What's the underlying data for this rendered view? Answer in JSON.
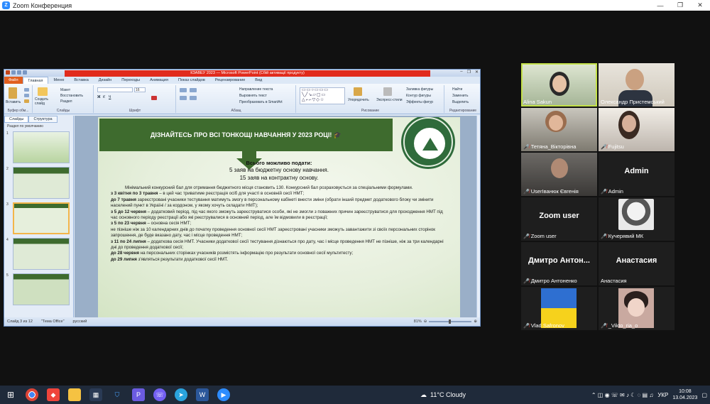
{
  "zoom_window": {
    "title": "Zoom Конференция",
    "controls": [
      "—",
      "❐",
      "✕"
    ]
  },
  "ppt": {
    "title": "КЗАВЕУ 2023 — Microsoft PowerPoint (Сбій активації продукту)",
    "tabs": [
      "Файл",
      "Главная",
      "Меню",
      "Вставка",
      "Дизайн",
      "Переходы",
      "Анимация",
      "Показ слайдов",
      "Рецензирование",
      "Вид"
    ],
    "ribbon": {
      "clipboard_label": "Буфер обм...",
      "insert_btn": "Вставить",
      "create_slide": "Создать слайд",
      "macro": "Макет",
      "restore": "Восстановить",
      "section": "Раздел",
      "slides_label": "Слайды",
      "font_label": "Шрифт",
      "font_size": "16",
      "paragraph_label": "Абзац",
      "text_dir": "Направление текста",
      "align_text": "Выровнять текст",
      "smartart": "Преобразовать в SmartArt",
      "drawing_label": "Рисование",
      "arrange": "Упорядочить",
      "quick_styles": "Экспресс-стили",
      "fill": "Заливка фигуры",
      "outline": "Контур фигуры",
      "effects": "Эффекты фигур",
      "find": "Найти",
      "replace": "Заменить",
      "select": "Выделить",
      "editing_label": "Редактирование"
    },
    "slides_pane": {
      "tabs": [
        "Слайды",
        "Структура"
      ],
      "section": "Раздел по умолчанию",
      "thumbs": [
        "1",
        "2",
        "3",
        "4",
        "5"
      ]
    },
    "slide": {
      "banner": "ДІЗНАЙТЕСЬ ПРО ВСІ ТОНКОЩІ НАВЧАННЯ У 2023 РОЦІ! 🎓",
      "heading": "Всього можливо подати:",
      "line1": "5 заяв на бюджетну основу навчання.",
      "line2": "15 заяв на контрактну основу.",
      "p1": "Мінімальний конкурсний бал для отримання бюджетного місця становить 130. Конкурсний бал розраховується за спеціальними формулами.",
      "b1": "з 3 квітня по 3 травня",
      "t1": " – в цей час триватиме реєстрація осіб для участі в основній сесії НМТ;",
      "b2": "до 7 травня",
      "t2": " зареєстровані учасники тестування матимуть змогу в персональному кабінеті внести зміни (обрати інший предмет додаткового блоку чи змінити населений пункт в Україні / за кордоном, у якому хочуть складати НМТ);",
      "b3": "з 5 до 12 червня",
      "t3": " – додатковий період, під час якого зможуть зареєструватися особи, які не змогли з поважних причин зареєструватися для проходження НМТ під час основного періоду реєстрації або які реєструвалися в основний період, але їм відмовили в реєстрації;",
      "b4": "з 5 по 23 червня",
      "t4": " – основна сесія НМТ;",
      "t5": "не пізніше ніж за 10 календарних днів до початку проведення основної сесії НМТ зареєстровані учасники зможуть завантажити зі своїх персональних сторінок запрошення, де буде вказано дату, час і місце проведення НМТ;",
      "b6": "з 11 по 24 липня",
      "t6": " – додаткова сесія НМТ. Учасники додаткової сесії тестування дізнаються про дату, час і місце проведення НМТ не пізніше, ніж за три календарні дні до проведення додаткової сесії;",
      "b7": "до 28 червня",
      "t7": " на персональних сторінках учасників розмістять інформацію про результати основної сесії мультитесту;",
      "b8": "до 29 липня",
      "t8": " з'являться результати додаткової сесії НМТ."
    },
    "status": {
      "slide": "Слайд 3 из 12",
      "theme": "\"Тема Office\"",
      "lang": "русский",
      "zoom": "81%"
    }
  },
  "participants": [
    {
      "name": "Alina Sakun",
      "muted": false,
      "video": true
    },
    {
      "name": "Олександр Пристемський",
      "muted": false,
      "video": true
    },
    {
      "name": "Тетяна_Вікторівна",
      "muted": true,
      "video": true
    },
    {
      "name": "Fujitsu",
      "muted": true,
      "video": true
    },
    {
      "name": "UserІванюк Євгенія",
      "muted": true,
      "video": true
    },
    {
      "name": "Admin",
      "muted": true,
      "video": false,
      "display": "Admin"
    },
    {
      "name": "Zoom user",
      "muted": true,
      "video": false,
      "display": "Zoom user"
    },
    {
      "name": "Кучерявий МК",
      "muted": true,
      "video": true
    },
    {
      "name": "Дмитро Антоненко",
      "muted": true,
      "video": false,
      "display": "Дмитро Антон..."
    },
    {
      "name": "Анастасия",
      "muted": false,
      "video": false,
      "display": "Анастасия"
    },
    {
      "name": "Vlad Safronov",
      "muted": true,
      "video": true
    },
    {
      "name": "_Vikto_ria_o",
      "muted": true,
      "video": true
    }
  ],
  "taskbar": {
    "weather": "11°C  Cloudy",
    "lang": "УКР",
    "time": "10:08",
    "date": "13.04.2023"
  }
}
